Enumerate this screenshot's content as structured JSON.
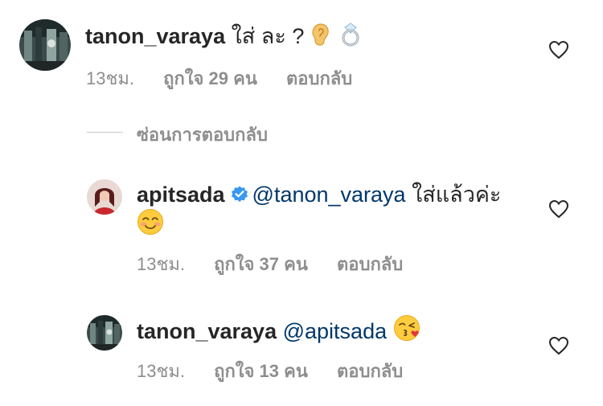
{
  "comments": [
    {
      "username": "tanon_varaya",
      "text": "ใส่ ละ ?",
      "emojis": [
        "ear-emoji",
        "ring-emoji"
      ],
      "time": "13ชม.",
      "likes": "ถูกใจ 29 คน",
      "reply": "ตอบกลับ"
    }
  ],
  "hide_replies_label": "ซ่อนการตอบกลับ",
  "replies": [
    {
      "username": "apitsada",
      "verified": true,
      "mention": "@tanon_varaya",
      "text": "ใส่แล้วค่ะ",
      "emojis": [
        "smiling-blush-emoji"
      ],
      "time": "13ชม.",
      "likes": "ถูกใจ 37 คน",
      "reply": "ตอบกลับ"
    },
    {
      "username": "tanon_varaya",
      "mention": "@apitsada",
      "text": "",
      "emojis": [
        "kiss-emoji"
      ],
      "time": "13ชม.",
      "likes": "ถูกใจ 13 คน",
      "reply": "ตอบกลับ"
    }
  ],
  "colors": {
    "text": "#262626",
    "mention": "#00376b",
    "muted": "#8e8e8e",
    "verified": "#3897f0",
    "divider": "#c7c7c7"
  }
}
